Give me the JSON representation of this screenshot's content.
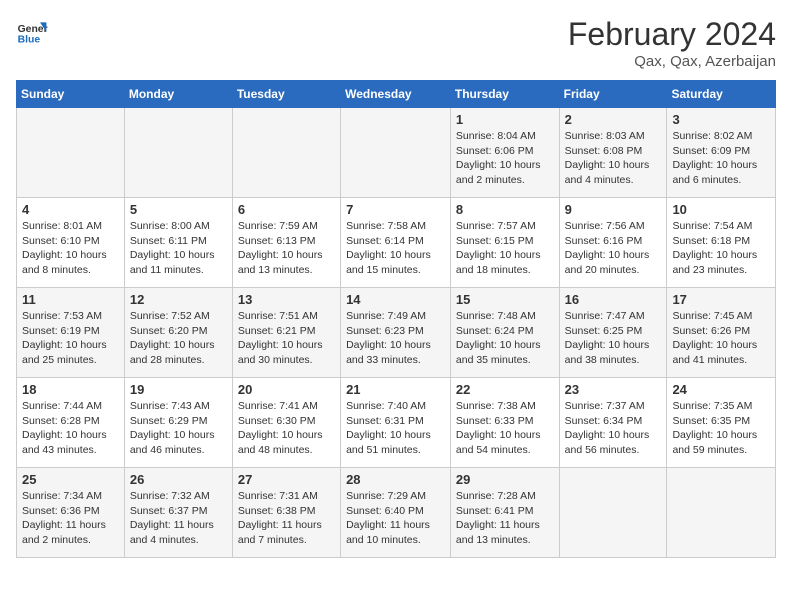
{
  "header": {
    "logo_line1": "General",
    "logo_line2": "Blue",
    "title": "February 2024",
    "subtitle": "Qax, Qax, Azerbaijan"
  },
  "days_of_week": [
    "Sunday",
    "Monday",
    "Tuesday",
    "Wednesday",
    "Thursday",
    "Friday",
    "Saturday"
  ],
  "weeks": [
    [
      {
        "day": "",
        "info": ""
      },
      {
        "day": "",
        "info": ""
      },
      {
        "day": "",
        "info": ""
      },
      {
        "day": "",
        "info": ""
      },
      {
        "day": "1",
        "info": "Sunrise: 8:04 AM\nSunset: 6:06 PM\nDaylight: 10 hours\nand 2 minutes."
      },
      {
        "day": "2",
        "info": "Sunrise: 8:03 AM\nSunset: 6:08 PM\nDaylight: 10 hours\nand 4 minutes."
      },
      {
        "day": "3",
        "info": "Sunrise: 8:02 AM\nSunset: 6:09 PM\nDaylight: 10 hours\nand 6 minutes."
      }
    ],
    [
      {
        "day": "4",
        "info": "Sunrise: 8:01 AM\nSunset: 6:10 PM\nDaylight: 10 hours\nand 8 minutes."
      },
      {
        "day": "5",
        "info": "Sunrise: 8:00 AM\nSunset: 6:11 PM\nDaylight: 10 hours\nand 11 minutes."
      },
      {
        "day": "6",
        "info": "Sunrise: 7:59 AM\nSunset: 6:13 PM\nDaylight: 10 hours\nand 13 minutes."
      },
      {
        "day": "7",
        "info": "Sunrise: 7:58 AM\nSunset: 6:14 PM\nDaylight: 10 hours\nand 15 minutes."
      },
      {
        "day": "8",
        "info": "Sunrise: 7:57 AM\nSunset: 6:15 PM\nDaylight: 10 hours\nand 18 minutes."
      },
      {
        "day": "9",
        "info": "Sunrise: 7:56 AM\nSunset: 6:16 PM\nDaylight: 10 hours\nand 20 minutes."
      },
      {
        "day": "10",
        "info": "Sunrise: 7:54 AM\nSunset: 6:18 PM\nDaylight: 10 hours\nand 23 minutes."
      }
    ],
    [
      {
        "day": "11",
        "info": "Sunrise: 7:53 AM\nSunset: 6:19 PM\nDaylight: 10 hours\nand 25 minutes."
      },
      {
        "day": "12",
        "info": "Sunrise: 7:52 AM\nSunset: 6:20 PM\nDaylight: 10 hours\nand 28 minutes."
      },
      {
        "day": "13",
        "info": "Sunrise: 7:51 AM\nSunset: 6:21 PM\nDaylight: 10 hours\nand 30 minutes."
      },
      {
        "day": "14",
        "info": "Sunrise: 7:49 AM\nSunset: 6:23 PM\nDaylight: 10 hours\nand 33 minutes."
      },
      {
        "day": "15",
        "info": "Sunrise: 7:48 AM\nSunset: 6:24 PM\nDaylight: 10 hours\nand 35 minutes."
      },
      {
        "day": "16",
        "info": "Sunrise: 7:47 AM\nSunset: 6:25 PM\nDaylight: 10 hours\nand 38 minutes."
      },
      {
        "day": "17",
        "info": "Sunrise: 7:45 AM\nSunset: 6:26 PM\nDaylight: 10 hours\nand 41 minutes."
      }
    ],
    [
      {
        "day": "18",
        "info": "Sunrise: 7:44 AM\nSunset: 6:28 PM\nDaylight: 10 hours\nand 43 minutes."
      },
      {
        "day": "19",
        "info": "Sunrise: 7:43 AM\nSunset: 6:29 PM\nDaylight: 10 hours\nand 46 minutes."
      },
      {
        "day": "20",
        "info": "Sunrise: 7:41 AM\nSunset: 6:30 PM\nDaylight: 10 hours\nand 48 minutes."
      },
      {
        "day": "21",
        "info": "Sunrise: 7:40 AM\nSunset: 6:31 PM\nDaylight: 10 hours\nand 51 minutes."
      },
      {
        "day": "22",
        "info": "Sunrise: 7:38 AM\nSunset: 6:33 PM\nDaylight: 10 hours\nand 54 minutes."
      },
      {
        "day": "23",
        "info": "Sunrise: 7:37 AM\nSunset: 6:34 PM\nDaylight: 10 hours\nand 56 minutes."
      },
      {
        "day": "24",
        "info": "Sunrise: 7:35 AM\nSunset: 6:35 PM\nDaylight: 10 hours\nand 59 minutes."
      }
    ],
    [
      {
        "day": "25",
        "info": "Sunrise: 7:34 AM\nSunset: 6:36 PM\nDaylight: 11 hours\nand 2 minutes."
      },
      {
        "day": "26",
        "info": "Sunrise: 7:32 AM\nSunset: 6:37 PM\nDaylight: 11 hours\nand 4 minutes."
      },
      {
        "day": "27",
        "info": "Sunrise: 7:31 AM\nSunset: 6:38 PM\nDaylight: 11 hours\nand 7 minutes."
      },
      {
        "day": "28",
        "info": "Sunrise: 7:29 AM\nSunset: 6:40 PM\nDaylight: 11 hours\nand 10 minutes."
      },
      {
        "day": "29",
        "info": "Sunrise: 7:28 AM\nSunset: 6:41 PM\nDaylight: 11 hours\nand 13 minutes."
      },
      {
        "day": "",
        "info": ""
      },
      {
        "day": "",
        "info": ""
      }
    ]
  ]
}
